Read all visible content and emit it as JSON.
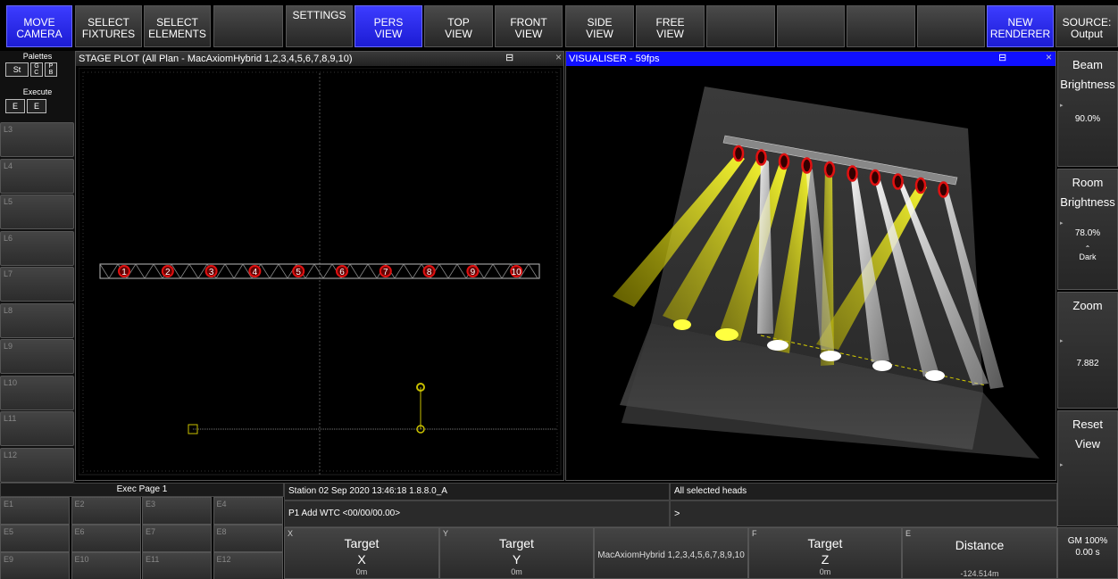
{
  "top_buttons": [
    {
      "label": "MOVE\nCAMERA",
      "active": true
    },
    {
      "label": "SELECT\nFIXTURES",
      "active": false
    },
    {
      "label": "SELECT\nELEMENTS",
      "active": false
    },
    {
      "label": "",
      "active": false
    },
    {
      "label": "SETTINGS",
      "active": false
    },
    {
      "label": "PERS\nVIEW",
      "active": true
    },
    {
      "label": "TOP\nVIEW",
      "active": false
    },
    {
      "label": "FRONT\nVIEW",
      "active": false
    },
    {
      "label": "SIDE\nVIEW",
      "active": false
    },
    {
      "label": "FREE\nVIEW",
      "active": false
    },
    {
      "label": "",
      "active": false
    },
    {
      "label": "",
      "active": false
    },
    {
      "label": "",
      "active": false
    },
    {
      "label": "",
      "active": false
    },
    {
      "label": "NEW\nRENDERER",
      "active": true
    },
    {
      "label": "SOURCE:\nOutput",
      "active": false
    }
  ],
  "left": {
    "palettes_label": "Palettes",
    "palette_buttons": [
      "St",
      "G\nC",
      "P\nB"
    ],
    "execute_label": "Execute",
    "execute_buttons": [
      "E",
      "E"
    ],
    "slots": [
      "L3",
      "L4",
      "L5",
      "L6",
      "L7",
      "L8",
      "L9",
      "L10",
      "L11",
      "L12"
    ]
  },
  "stage_plot": {
    "title": "STAGE PLOT (All Plan - MacAxiomHybrid 1,2,3,4,5,6,7,8,9,10)",
    "fixtures": [
      "1",
      "2",
      "3",
      "4",
      "5",
      "6",
      "7",
      "8",
      "9",
      "10"
    ]
  },
  "visualiser": {
    "title": "VISUALISER - 59fps"
  },
  "right_panel": [
    {
      "title": "Beam\nBrightness",
      "value": "90.0%",
      "sub": ""
    },
    {
      "title": "Room\nBrightness",
      "value": "78.0%",
      "sub": "Dark"
    },
    {
      "title": "Zoom",
      "value": "7.882",
      "sub": ""
    },
    {
      "title": "Reset\nView",
      "value": "",
      "sub": ""
    }
  ],
  "exec": {
    "title": "Exec Page 1",
    "slots": [
      "E1",
      "E2",
      "E3",
      "E4",
      "E5",
      "E6",
      "E7",
      "E8",
      "E9",
      "E10",
      "E11",
      "E12"
    ]
  },
  "status": {
    "station": "Station 02 Sep 2020 13:46:18 1.8.8.0_A",
    "command": "P1 Add WTC <00/00/00.00>",
    "selected": "All selected heads",
    "prompt": ">"
  },
  "encoders": [
    {
      "letter": "X",
      "title": "Target\nX",
      "value": "0m"
    },
    {
      "letter": "Y",
      "title": "Target\nY",
      "value": "0m"
    },
    {
      "letter": "",
      "title": "MacAxiomHybrid 1,2,3,4,5,6,7,8,9,10",
      "value": ""
    },
    {
      "letter": "F",
      "title": "Target\nZ",
      "value": "0m"
    },
    {
      "letter": "E",
      "title": "Distance",
      "value": "-124.514m"
    }
  ],
  "gm": {
    "level": "GM 100%",
    "time": "0.00 s"
  },
  "colors": {
    "accent": "#2424e0",
    "beam_yellow": "#e8e000",
    "fixture_red": "#d01010",
    "panel": "#2c2c2c"
  }
}
